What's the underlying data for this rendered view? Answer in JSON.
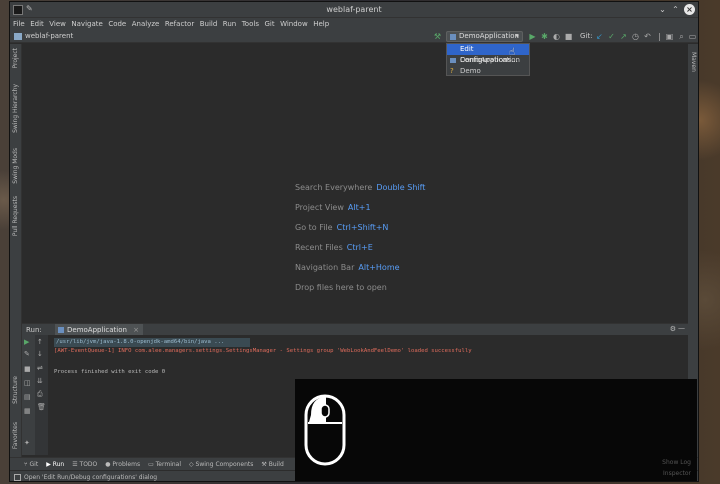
{
  "window": {
    "title": "weblaf-parent"
  },
  "menu": [
    "File",
    "Edit",
    "View",
    "Navigate",
    "Code",
    "Analyze",
    "Refactor",
    "Build",
    "Run",
    "Tools",
    "Git",
    "Window",
    "Help"
  ],
  "navbar": {
    "breadcrumb": "weblaf-parent",
    "run_config": "DemoApplication",
    "git_label": "Git:"
  },
  "dropdown": {
    "items": [
      {
        "label": "Edit Configurations...",
        "selected": true
      },
      {
        "label": "DemoApplication",
        "selected": false
      },
      {
        "label": "Demo",
        "selected": false
      }
    ]
  },
  "left_tabs": [
    "Project",
    "Swing Hierarchy",
    "Swing Mods",
    "Pull Requests",
    "Structure",
    "Favorites"
  ],
  "right_tabs": [
    "Maven"
  ],
  "editor_hints": [
    {
      "label": "Search Everywhere",
      "key": "Double Shift"
    },
    {
      "label": "Project View",
      "key": "Alt+1"
    },
    {
      "label": "Go to File",
      "key": "Ctrl+Shift+N"
    },
    {
      "label": "Recent Files",
      "key": "Ctrl+E"
    },
    {
      "label": "Navigation Bar",
      "key": "Alt+Home"
    },
    {
      "label": "Drop files here to open",
      "key": ""
    }
  ],
  "run_panel": {
    "label": "Run:",
    "tab": "DemoApplication",
    "command": "/usr/lib/jvm/java-1.8.0-openjdk-amd64/bin/java ...",
    "error_line": "[AWT-EventQueue-1] INFO com.alee.managers.settings.SettingsManager - Settings group 'WebLookAndFeelDemo' loaded successfully",
    "exit_line": "Process finished with exit code 0"
  },
  "bottom_tabs": [
    "Git",
    "Run",
    "TODO",
    "Problems",
    "Terminal",
    "Swing Components",
    "Build"
  ],
  "status": {
    "message": "Open 'Edit Run/Debug configurations' dialog"
  },
  "overlay": {
    "text1": "Show Log",
    "text2": "Inspector"
  },
  "colors": {
    "accent": "#2f65ca",
    "link_key": "#589df6",
    "error_text": "#e06c5c",
    "editor_bg": "#2b2b2b",
    "chrome_bg": "#3c3f41"
  }
}
